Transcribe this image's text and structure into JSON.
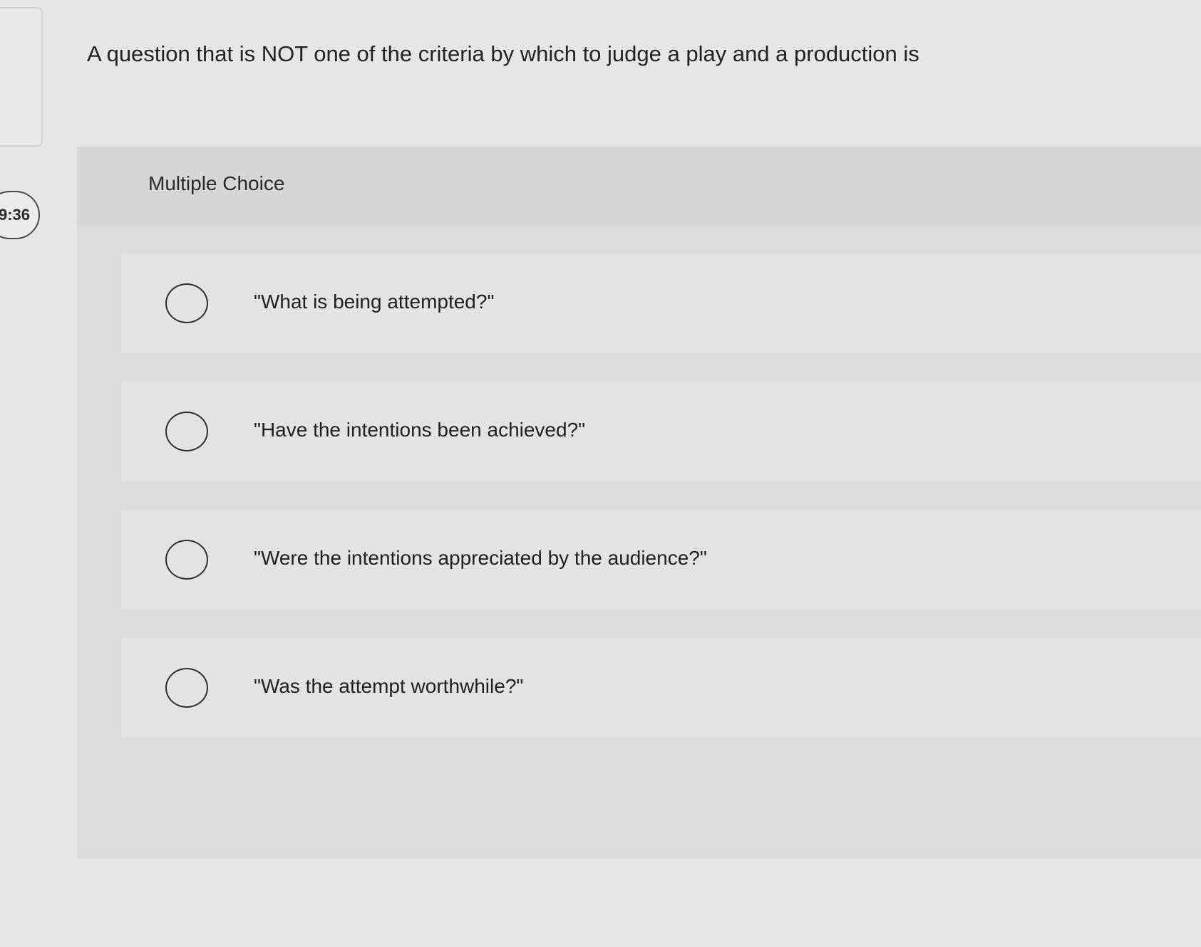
{
  "timer": {
    "text": "9:36"
  },
  "question": {
    "text": "A question that is NOT one of the criteria by which to judge a play and a production is"
  },
  "choice_panel": {
    "type_label": "Multiple Choice",
    "options": [
      {
        "label": "\"What is being attempted?\"",
        "selected": false
      },
      {
        "label": "\"Have the intentions been achieved?\"",
        "selected": false
      },
      {
        "label": "\"Were the intentions appreciated by the audience?\"",
        "selected": false
      },
      {
        "label": "\"Was the attempt worthwhile?\"",
        "selected": false
      }
    ]
  }
}
